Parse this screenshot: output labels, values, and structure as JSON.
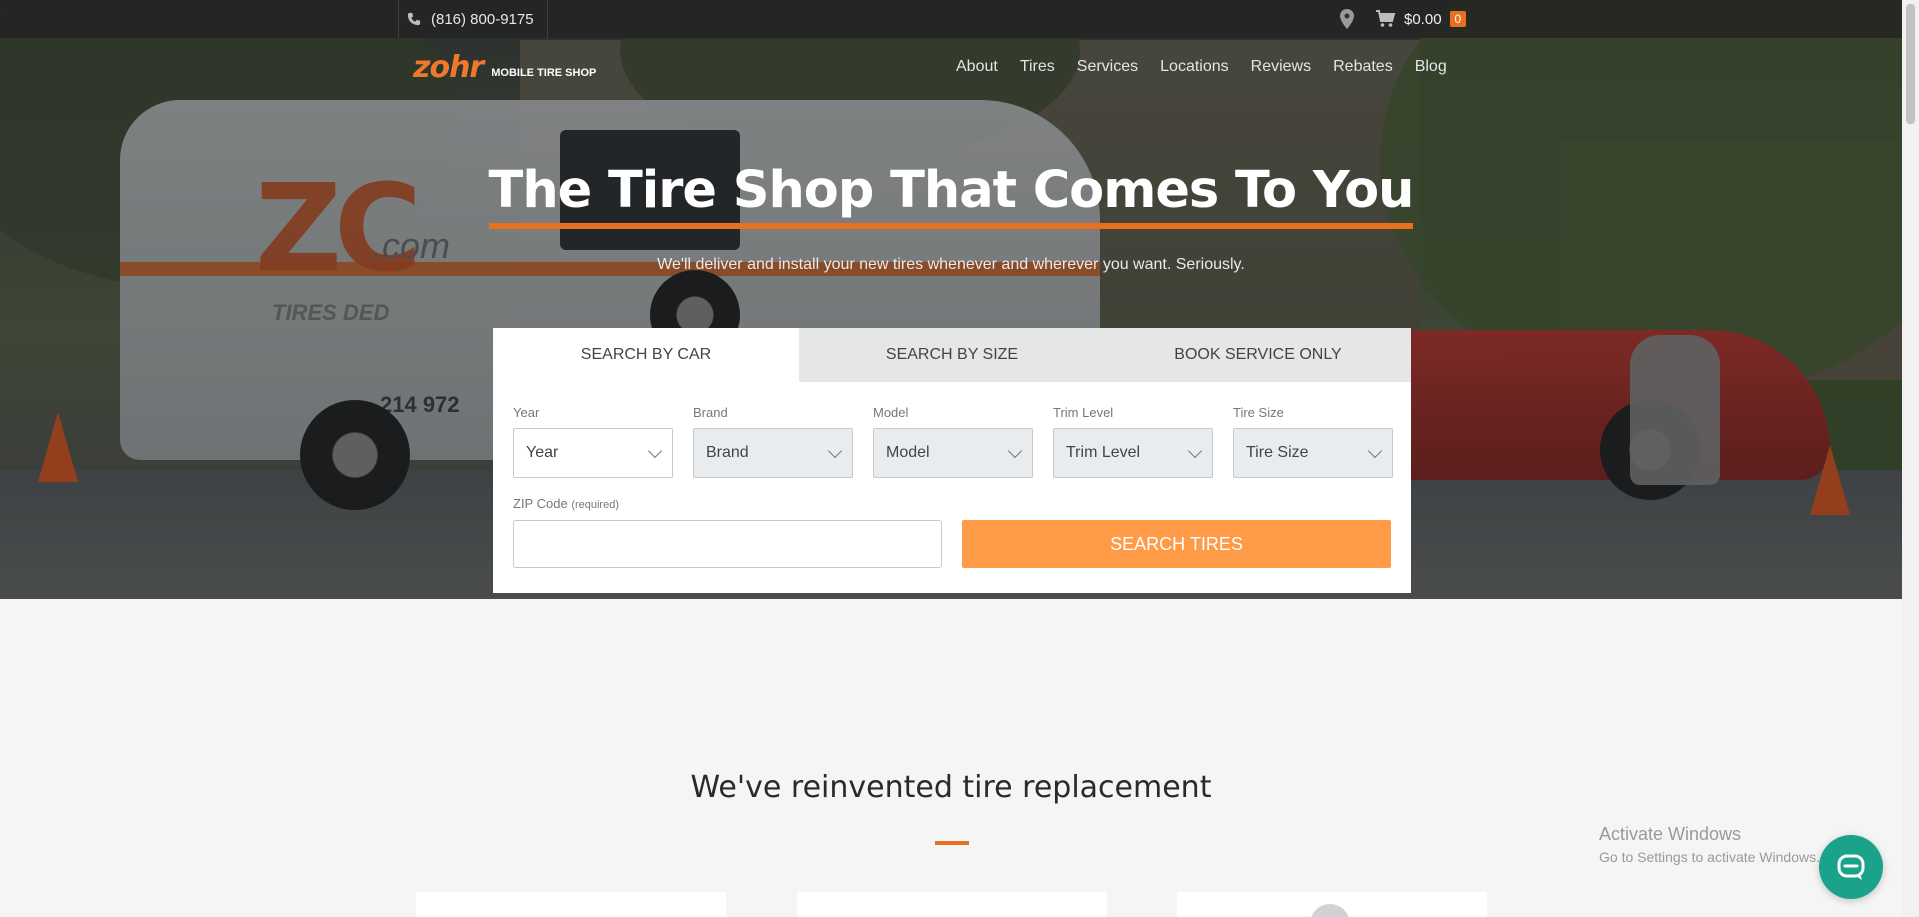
{
  "topbar": {
    "phone": "(816) 800-9175",
    "cart_amount": "$0.00",
    "cart_count": "0"
  },
  "brand": {
    "logo_text": "zohr",
    "logo_sub": "MOBILE TIRE SHOP",
    "accent_color": "#e8701f"
  },
  "nav": {
    "items": [
      "About",
      "Tires",
      "Services",
      "Locations",
      "Reviews",
      "Rebates",
      "Blog"
    ]
  },
  "hero": {
    "title": "The Tire Shop That Comes To You",
    "subtitle": "We'll deliver and install your new tires whenever and wherever you want. Seriously.",
    "van_logo": "ZC",
    "van_com": ".com",
    "van_tires": "TIRES DED",
    "van_phone": "214 972"
  },
  "search": {
    "tabs": [
      "SEARCH BY CAR",
      "SEARCH BY SIZE",
      "BOOK SERVICE ONLY"
    ],
    "active_tab": "SEARCH BY CAR",
    "fields": [
      {
        "label": "Year",
        "value": "Year"
      },
      {
        "label": "Brand",
        "value": "Brand"
      },
      {
        "label": "Model",
        "value": "Model"
      },
      {
        "label": "Trim Level",
        "value": "Trim Level"
      },
      {
        "label": "Tire Size",
        "value": "Tire Size"
      }
    ],
    "zip_label": "ZIP Code",
    "zip_required": "(required)",
    "zip_value": "",
    "button_label": "SEARCH TIRES",
    "button_color": "#ff9b47"
  },
  "section": {
    "title": "We've reinvented tire replacement"
  },
  "watermark": {
    "line1": "Activate Windows",
    "line2": "Go to Settings to activate Windows."
  },
  "icons": {
    "phone": "phone-icon",
    "location": "map-pin-icon",
    "cart": "cart-icon",
    "chat": "chat-icon",
    "chevron": "chevron-down-icon"
  }
}
